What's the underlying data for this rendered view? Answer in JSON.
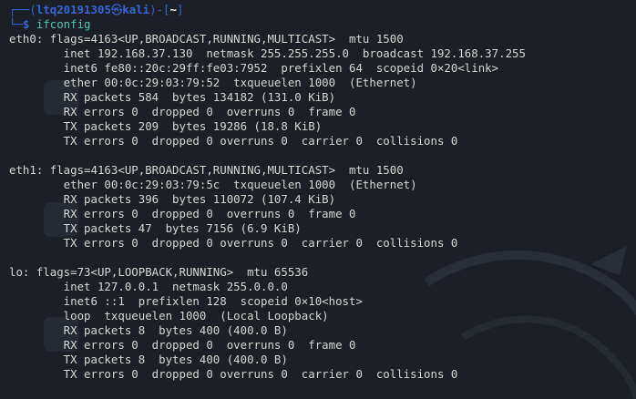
{
  "terminal": {
    "prompt": {
      "user": "ltq20191305",
      "host": "kali",
      "path": "~",
      "command": "ifconfig"
    },
    "interfaces": [
      {
        "lines": [
          "eth0: flags=4163<UP,BROADCAST,RUNNING,MULTICAST>  mtu 1500",
          "        inet 192.168.37.130  netmask 255.255.255.0  broadcast 192.168.37.255",
          "        inet6 fe80::20c:29ff:fe03:7952  prefixlen 64  scopeid 0×20<link>",
          "        ether 00:0c:29:03:79:52  txqueuelen 1000  (Ethernet)",
          "        RX packets 584  bytes 134182 (131.0 KiB)",
          "        RX errors 0  dropped 0  overruns 0  frame 0",
          "        TX packets 209  bytes 19286 (18.8 KiB)",
          "        TX errors 0  dropped 0 overruns 0  carrier 0  collisions 0"
        ]
      },
      {
        "lines": [
          "eth1: flags=4163<UP,BROADCAST,RUNNING,MULTICAST>  mtu 1500",
          "        ether 00:0c:29:03:79:5c  txqueuelen 1000  (Ethernet)",
          "        RX packets 396  bytes 110072 (107.4 KiB)",
          "        RX errors 0  dropped 0  overruns 0  frame 0",
          "        TX packets 47  bytes 7156 (6.9 KiB)",
          "        TX errors 0  dropped 0 overruns 0  carrier 0  collisions 0"
        ]
      },
      {
        "lines": [
          "lo: flags=73<UP,LOOPBACK,RUNNING>  mtu 65536",
          "        inet 127.0.0.1  netmask 255.0.0.0",
          "        inet6 ::1  prefixlen 128  scopeid 0×10<host>",
          "        loop  txqueuelen 1000  (Local Loopback)",
          "        RX packets 8  bytes 400 (400.0 B)",
          "        RX errors 0  dropped 0  overruns 0  frame 0",
          "        TX packets 8  bytes 400 (400.0 B)",
          "        TX errors 0  dropped 0 overruns 0  carrier 0  collisions 0"
        ]
      }
    ]
  },
  "colors": {
    "background": "#1c1f26",
    "prompt_accent": "#3465d4",
    "command": "#4ec9b0",
    "output_text": "#d3d7cf"
  }
}
